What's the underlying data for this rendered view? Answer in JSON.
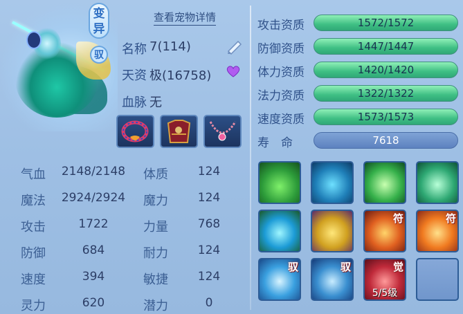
{
  "header": {
    "badge_transform": "变\n异",
    "badge_mount": "驭",
    "detail_link": "查看宠物详情"
  },
  "info": {
    "name_label": "名称",
    "name_value": "7(114)",
    "talent_label": "天资",
    "talent_value": "极(16758)",
    "blood_label": "血脉",
    "blood_value": "无"
  },
  "equipment": [
    {
      "name": "necklace-ring-icon"
    },
    {
      "name": "armor-icon"
    },
    {
      "name": "chain-necklace-icon"
    }
  ],
  "stats": [
    {
      "label": "气血",
      "value": "2148/2148",
      "label2": "体质",
      "value2": "124"
    },
    {
      "label": "魔法",
      "value": "2924/2924",
      "label2": "魔力",
      "value2": "124"
    },
    {
      "label": "攻击",
      "value": "1722",
      "label2": "力量",
      "value2": "768"
    },
    {
      "label": "防御",
      "value": "684",
      "label2": "耐力",
      "value2": "124"
    },
    {
      "label": "速度",
      "value": "394",
      "label2": "敏捷",
      "value2": "124"
    },
    {
      "label": "灵力",
      "value": "620",
      "label2": "潜力",
      "value2": "0"
    }
  ],
  "qualities": [
    {
      "label": "攻击资质",
      "value": "1572/1572",
      "fill": 1.0
    },
    {
      "label": "防御资质",
      "value": "1447/1447",
      "fill": 1.0
    },
    {
      "label": "体力资质",
      "value": "1420/1420",
      "fill": 1.0
    },
    {
      "label": "法力资质",
      "value": "1322/1322",
      "fill": 1.0
    },
    {
      "label": "速度资质",
      "value": "1573/1573",
      "fill": 1.0
    }
  ],
  "life": {
    "label": "寿　命",
    "value": "7618"
  },
  "skills": [
    {
      "name": "skill-shadow-fighter",
      "tag": "",
      "level": ""
    },
    {
      "name": "skill-ghost-figure",
      "tag": "",
      "level": ""
    },
    {
      "name": "skill-blade-spin",
      "tag": "",
      "level": ""
    },
    {
      "name": "skill-whirlwind",
      "tag": "",
      "level": ""
    },
    {
      "name": "skill-blue-flame",
      "tag": "",
      "level": ""
    },
    {
      "name": "skill-golden-shield",
      "tag": "",
      "level": ""
    },
    {
      "name": "skill-fire-rune",
      "tag": "符",
      "level": ""
    },
    {
      "name": "skill-flame-sword-rune",
      "tag": "符",
      "level": ""
    },
    {
      "name": "skill-water-wave",
      "tag": "驭",
      "level": ""
    },
    {
      "name": "skill-ice-blade",
      "tag": "驭",
      "level": ""
    },
    {
      "name": "skill-awaken",
      "tag": "觉",
      "level": "5/5级"
    },
    {
      "name": "skill-empty-slot",
      "tag": "",
      "level": ""
    }
  ]
}
